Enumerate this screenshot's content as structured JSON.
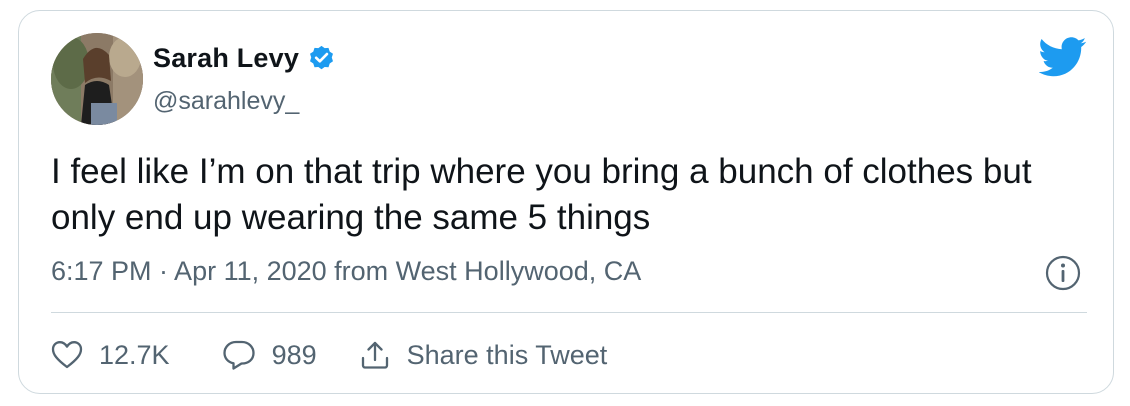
{
  "author": {
    "display_name": "Sarah Levy",
    "handle": "@sarahlevy_",
    "verified": true
  },
  "tweet": {
    "text": "I feel like I’m on that trip where you bring a bunch of clothes but only end up wearing the same 5 things",
    "timestamp": "6:17 PM · Apr 11, 2020 from West Hollywood, CA"
  },
  "actions": {
    "likes": "12.7K",
    "replies": "989",
    "share_label": "Share this Tweet"
  },
  "icons": {
    "brand": "twitter-bird-icon",
    "verified": "verified-badge-icon",
    "info": "info-icon",
    "like": "heart-icon",
    "reply": "reply-bubble-icon",
    "share": "share-icon"
  },
  "colors": {
    "brand_blue": "#1d9bf0",
    "text_primary": "#0f1419",
    "text_secondary": "#536471",
    "border": "#cfd9de"
  }
}
